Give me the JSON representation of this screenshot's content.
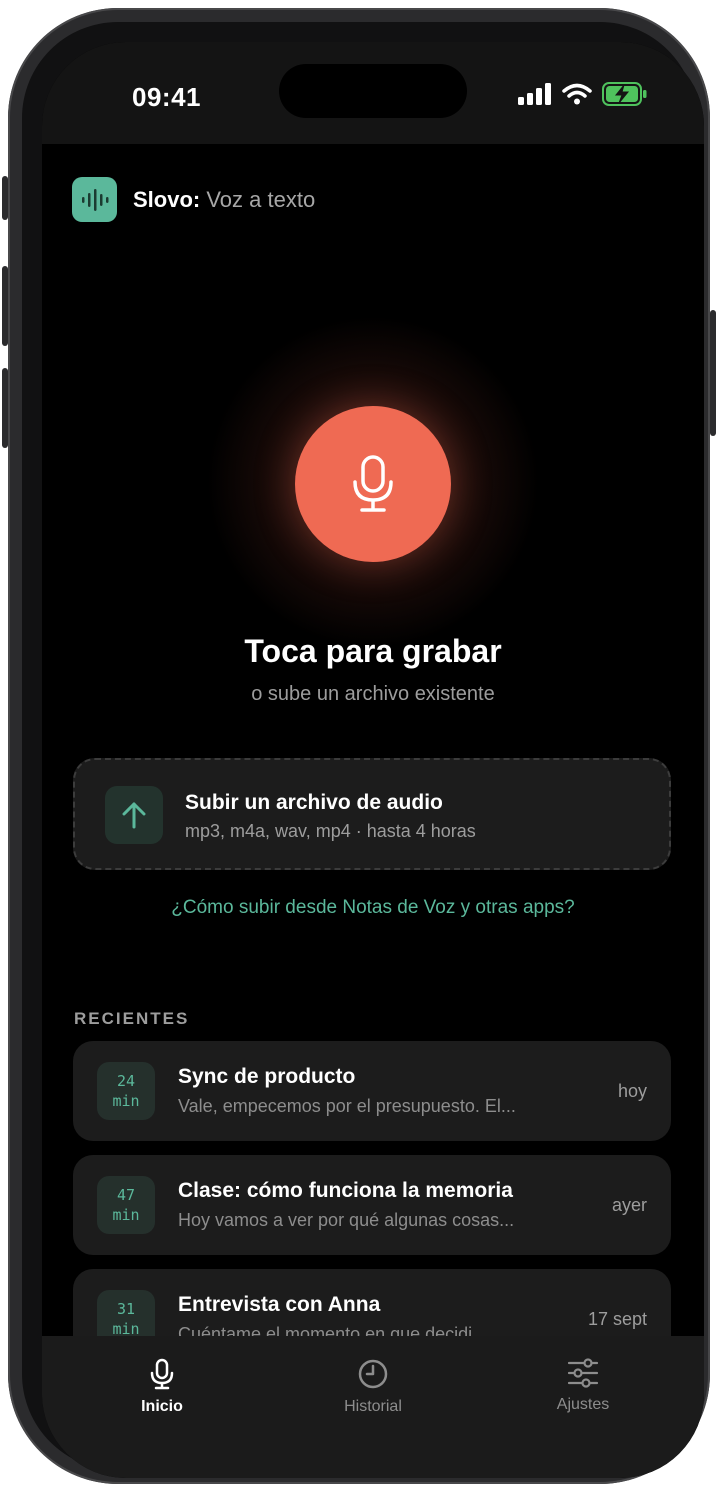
{
  "status_bar": {
    "time": "09:41"
  },
  "header": {
    "app_name": "Slovo",
    "separator": ":",
    "subtitle": " Voz a texto"
  },
  "record": {
    "title": "Toca para grabar",
    "subtitle": "o sube un archivo existente"
  },
  "upload": {
    "title": "Subir un archivo de audio",
    "subtitle": "mp3, m4a, wav, mp4 · hasta 4 horas"
  },
  "help_link": "¿Cómo subir desde Notas de Voz y otras apps?",
  "recents": {
    "label": "RECIENTES",
    "items": [
      {
        "duration": "24",
        "unit": "min",
        "title": "Sync de producto",
        "preview": "Vale, empecemos por el presupuesto. El...",
        "date": "hoy"
      },
      {
        "duration": "47",
        "unit": "min",
        "title": "Clase: cómo funciona la memoria",
        "preview": "Hoy vamos a ver por qué algunas cosas...",
        "date": "ayer"
      },
      {
        "duration": "31",
        "unit": "min",
        "title": "Entrevista con Anna",
        "preview": "Cuéntame el momento en que decidi...",
        "date": "17 sept"
      }
    ]
  },
  "tabs": [
    {
      "label": "Inicio",
      "icon": "mic-icon",
      "active": true
    },
    {
      "label": "Historial",
      "icon": "clock-icon",
      "active": false
    },
    {
      "label": "Ajustes",
      "icon": "sliders-icon",
      "active": false
    }
  ],
  "colors": {
    "accent": "#5bb89b",
    "record": "#ef6a53",
    "background": "#000000",
    "card": "#1c1c1c"
  }
}
